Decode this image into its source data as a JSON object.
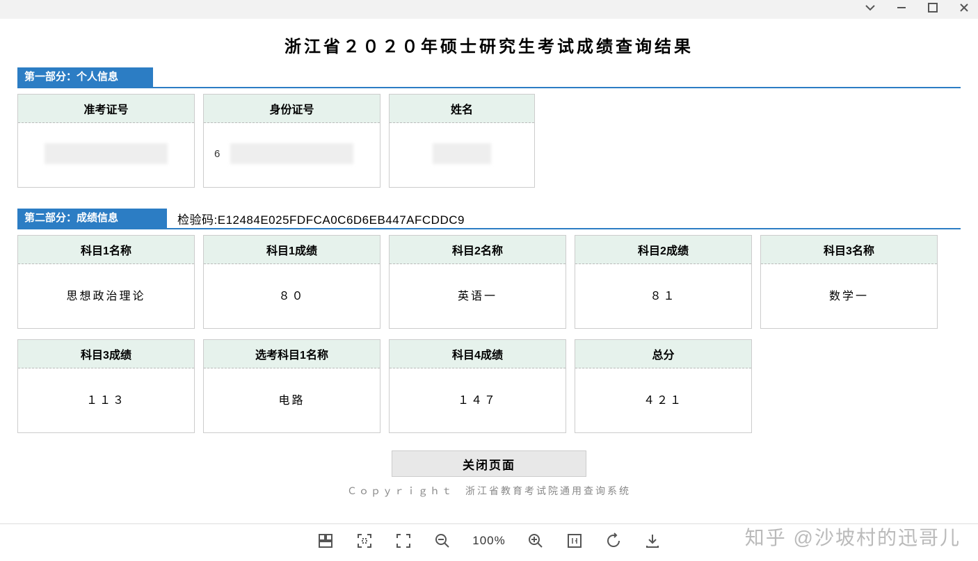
{
  "page_title": "浙江省２０２０年硕士研究生考试成绩查询结果",
  "section1": {
    "title": "第一部分：个人信息",
    "cards": [
      {
        "label": "准考证号",
        "value": ""
      },
      {
        "label": "身份证号",
        "value": ""
      },
      {
        "label": "姓名",
        "value": ""
      }
    ]
  },
  "section2": {
    "title": "第二部分：成绩信息",
    "verify_label": "检验码:",
    "verify_code": "E12484E025FDFCA0C6D6EB447AFCDDC9",
    "cards_row1": [
      {
        "label": "科目1名称",
        "value": "思想政治理论"
      },
      {
        "label": "科目1成绩",
        "value": "８０"
      },
      {
        "label": "科目2名称",
        "value": "英语一"
      },
      {
        "label": "科目2成绩",
        "value": "８１"
      },
      {
        "label": "科目3名称",
        "value": "数学一"
      }
    ],
    "cards_row2": [
      {
        "label": "科目3成绩",
        "value": "１１３"
      },
      {
        "label": "选考科目1名称",
        "value": "电路"
      },
      {
        "label": "科目4成绩",
        "value": "１４７"
      },
      {
        "label": "总分",
        "value": "４２１"
      }
    ]
  },
  "close_button": "关闭页面",
  "copyright": "Ｃｏｐｙｒｉｇｈｔ　浙江省教育考试院通用查询系统",
  "toolbar": {
    "zoom": "100%"
  },
  "watermark": "知乎 @沙坡村的迅哥儿",
  "redacted_partial": "6"
}
